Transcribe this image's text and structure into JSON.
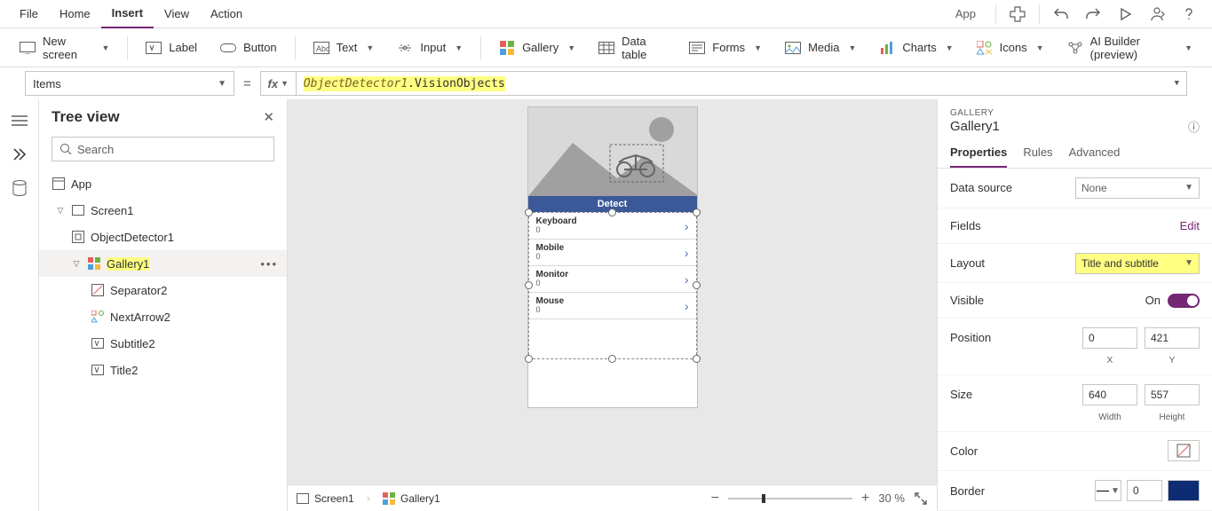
{
  "menu": {
    "items": [
      "File",
      "Home",
      "Insert",
      "View",
      "Action"
    ],
    "active": "Insert",
    "app": "App"
  },
  "ribbon": {
    "new_screen": "New screen",
    "label": "Label",
    "button": "Button",
    "text": "Text",
    "input": "Input",
    "gallery": "Gallery",
    "data_table": "Data table",
    "forms": "Forms",
    "media": "Media",
    "charts": "Charts",
    "icons": "Icons",
    "ai_builder": "AI Builder (preview)"
  },
  "formula": {
    "property": "Items",
    "expression_obj": "ObjectDetector1",
    "expression_field": ".VisionObjects"
  },
  "treeview": {
    "title": "Tree view",
    "search_placeholder": "Search",
    "app": "App",
    "screen": "Screen1",
    "od": "ObjectDetector1",
    "gallery": "Gallery1",
    "children": [
      "Separator2",
      "NextArrow2",
      "Subtitle2",
      "Title2"
    ]
  },
  "canvas": {
    "detect": "Detect",
    "items": [
      {
        "title": "Keyboard",
        "sub": "0"
      },
      {
        "title": "Mobile",
        "sub": "0"
      },
      {
        "title": "Monitor",
        "sub": "0"
      },
      {
        "title": "Mouse",
        "sub": "0"
      }
    ]
  },
  "footer": {
    "screen": "Screen1",
    "gallery": "Gallery1",
    "zoom": "30  %"
  },
  "rightpane": {
    "eyebrow": "GALLERY",
    "title": "Gallery1",
    "tabs": [
      "Properties",
      "Rules",
      "Advanced"
    ],
    "data_source": {
      "label": "Data source",
      "value": "None"
    },
    "fields": {
      "label": "Fields",
      "link": "Edit"
    },
    "layout": {
      "label": "Layout",
      "value": "Title and subtitle"
    },
    "visible": {
      "label": "Visible",
      "value": "On"
    },
    "position": {
      "label": "Position",
      "x": "0",
      "y": "421",
      "xlabel": "X",
      "ylabel": "Y"
    },
    "size": {
      "label": "Size",
      "w": "640",
      "h": "557",
      "wlabel": "Width",
      "hlabel": "Height"
    },
    "color": {
      "label": "Color"
    },
    "border": {
      "label": "Border",
      "value": "0"
    }
  }
}
